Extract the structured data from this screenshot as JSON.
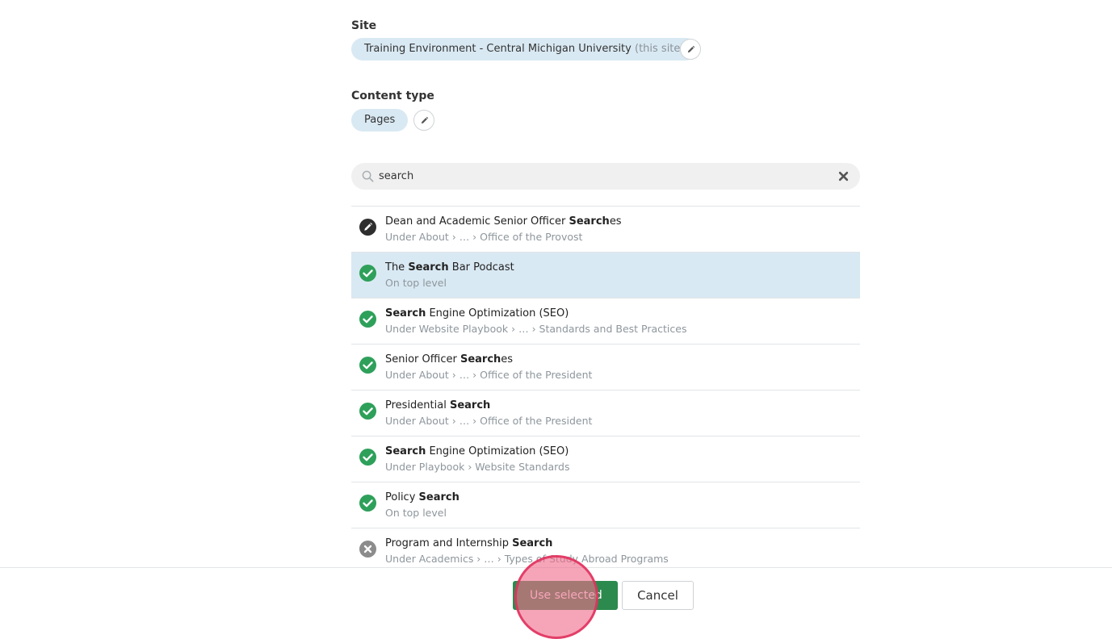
{
  "site": {
    "label": "Site",
    "value": "Training Environment - Central Michigan University",
    "suffix": "(this site)"
  },
  "content_type": {
    "label": "Content type",
    "value": "Pages"
  },
  "search": {
    "value": "search",
    "placeholder": "Search"
  },
  "results": [
    {
      "status": "edit",
      "pre": "Dean and Academic Senior Officer ",
      "match": "Search",
      "post": "es",
      "path": "Under About › … › Office of the Provost",
      "selected": false
    },
    {
      "status": "published",
      "pre": "The ",
      "match": "Search",
      "post": " Bar Podcast",
      "path": "On top level",
      "selected": true
    },
    {
      "status": "published",
      "pre": "",
      "match": "Search",
      "post": " Engine Optimization (SEO)",
      "path": "Under Website Playbook › … › Standards and Best Practices",
      "selected": false
    },
    {
      "status": "published",
      "pre": "Senior Officer ",
      "match": "Search",
      "post": "es",
      "path": "Under About › … › Office of the President",
      "selected": false
    },
    {
      "status": "published",
      "pre": "Presidential ",
      "match": "Search",
      "post": "",
      "path": "Under About › … › Office of the President",
      "selected": false
    },
    {
      "status": "published",
      "pre": "",
      "match": "Search",
      "post": " Engine Optimization (SEO)",
      "path": "Under Playbook › Website Standards",
      "selected": false
    },
    {
      "status": "published",
      "pre": "Policy ",
      "match": "Search",
      "post": "",
      "path": "On top level",
      "selected": false
    },
    {
      "status": "unpublished",
      "pre": "Program and Internship ",
      "match": "Search",
      "post": "",
      "path": "Under Academics › … › Types of Study Abroad Programs",
      "selected": false
    }
  ],
  "footer": {
    "use_selected_label": "Use selected",
    "cancel_label": "Cancel"
  },
  "colors": {
    "chip_bg": "#d9e9f3",
    "selected_row_bg": "#d9e9f3",
    "published": "#2ea05a",
    "edit": "#2e2e2e",
    "unpublished": "#8c8c8c",
    "primary_button": "#2c8a4e",
    "click_indicator": "#f06e8c"
  }
}
